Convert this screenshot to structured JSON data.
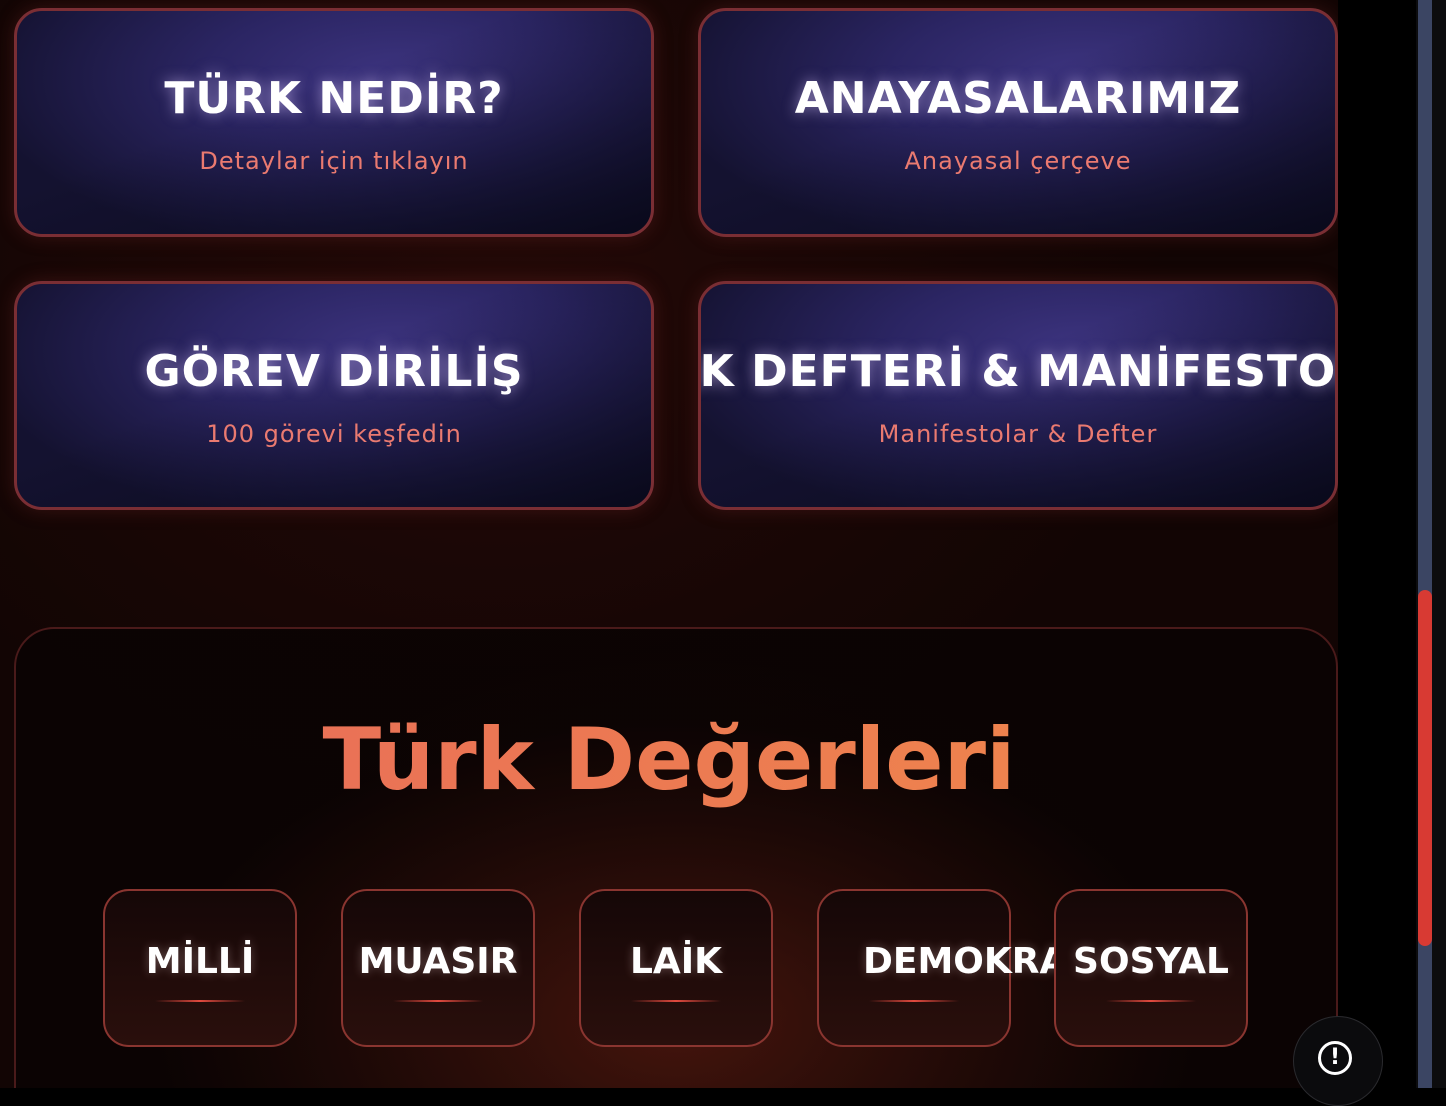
{
  "cards": [
    {
      "title": "TÜRK NEDİR?",
      "subtitle": "Detaylar için tıklayın"
    },
    {
      "title": "ANAYASALARIMIZ",
      "subtitle": "Anayasal çerçeve"
    },
    {
      "title": "GÖREV DİRİLİŞ",
      "subtitle": "100 görevi keşfedin"
    },
    {
      "title": "ALK DEFTERİ & MANİFESTOLA",
      "subtitle": "Manifestolar & Defter"
    }
  ],
  "values_section": {
    "title": "Türk Değerleri",
    "items": [
      {
        "label": "MİLLİ"
      },
      {
        "label": "MUASIR"
      },
      {
        "label": "LAİK"
      },
      {
        "label": "DEMOKRATİK"
      },
      {
        "label": "SOSYAL"
      }
    ]
  },
  "alert_button": {
    "icon": "exclamation-circle-icon",
    "glyph": "!"
  },
  "colors": {
    "card_border": "#7a2e34",
    "card_subtitle": "#ea7a70",
    "values_title": "#ee7a58",
    "scroll_thumb": "#d83a33"
  }
}
